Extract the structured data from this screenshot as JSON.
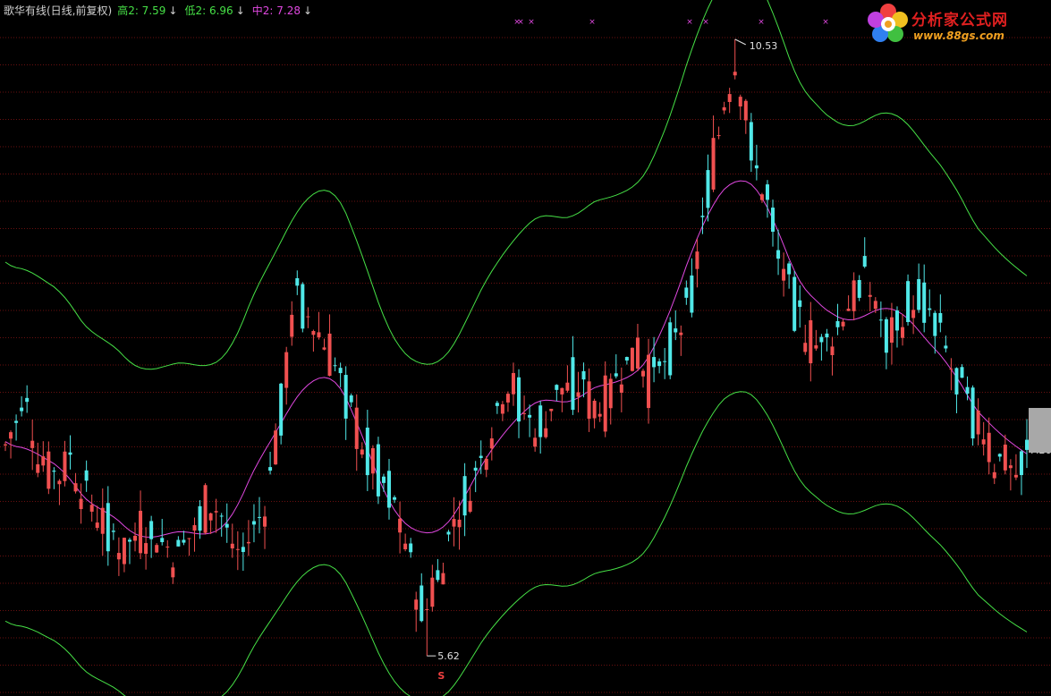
{
  "header": {
    "title": "歌华有线(日线,前复权)",
    "high_label": "高2: 7.59",
    "low_label": "低2: 6.96",
    "mid_label": "中2: 7.28",
    "arrow": "↓"
  },
  "logo": {
    "brand": "分析家公式网",
    "url": "www.88gs.com"
  },
  "colors": {
    "background": "#000000",
    "up_candle": "#f05050",
    "down_candle": "#50e8e8",
    "band_line": "#46e046",
    "mid_line": "#e048e0",
    "grid": "#6a1010",
    "marker": "#e048e0"
  },
  "chart_data": {
    "type": "candlestick",
    "y_range": [
      5.5,
      10.7
    ],
    "annotations": {
      "max_label": "10.53",
      "min_label": "5.62",
      "last_price_label": "7.26",
      "min_marker": "S"
    },
    "series": [
      {
        "name": "高2",
        "values": "upper band, ends at 7.59"
      },
      {
        "name": "低2",
        "values": "lower band, ends at 6.96"
      },
      {
        "name": "中2",
        "values": "mid line, ends at 7.28"
      }
    ],
    "close_path": [
      7.3,
      7.45,
      7.6,
      7.25,
      7.1,
      7.05,
      7.2,
      7.0,
      6.8,
      6.7,
      6.6,
      6.45,
      6.55,
      6.65,
      6.6,
      6.5,
      6.4,
      6.55,
      6.7,
      6.85,
      6.75,
      6.5,
      6.45,
      6.6,
      6.8,
      7.2,
      7.8,
      8.5,
      8.35,
      8.2,
      8.05,
      7.85,
      7.6,
      7.35,
      7.2,
      7.05,
      6.9,
      6.55,
      6.25,
      5.95,
      6.2,
      6.5,
      6.75,
      6.95,
      7.1,
      7.4,
      7.7,
      7.85,
      7.6,
      7.45,
      7.5,
      7.65,
      7.75,
      7.8,
      7.7,
      7.55,
      7.65,
      7.85,
      7.95,
      8.05,
      7.75,
      7.9,
      8.1,
      8.25,
      8.55,
      9.2,
      9.6,
      10.1,
      10.35,
      9.9,
      9.4,
      9.3,
      8.75,
      8.5,
      8.3,
      8.1,
      8.05,
      8.2,
      8.35,
      8.5,
      8.6,
      8.4,
      8.15,
      8.3,
      8.45,
      8.5,
      8.35,
      8.15,
      7.9,
      7.7,
      7.55,
      7.4,
      7.15,
      7.2,
      7.05,
      7.26
    ],
    "max": 10.53,
    "min": 5.62,
    "last": 7.26
  }
}
